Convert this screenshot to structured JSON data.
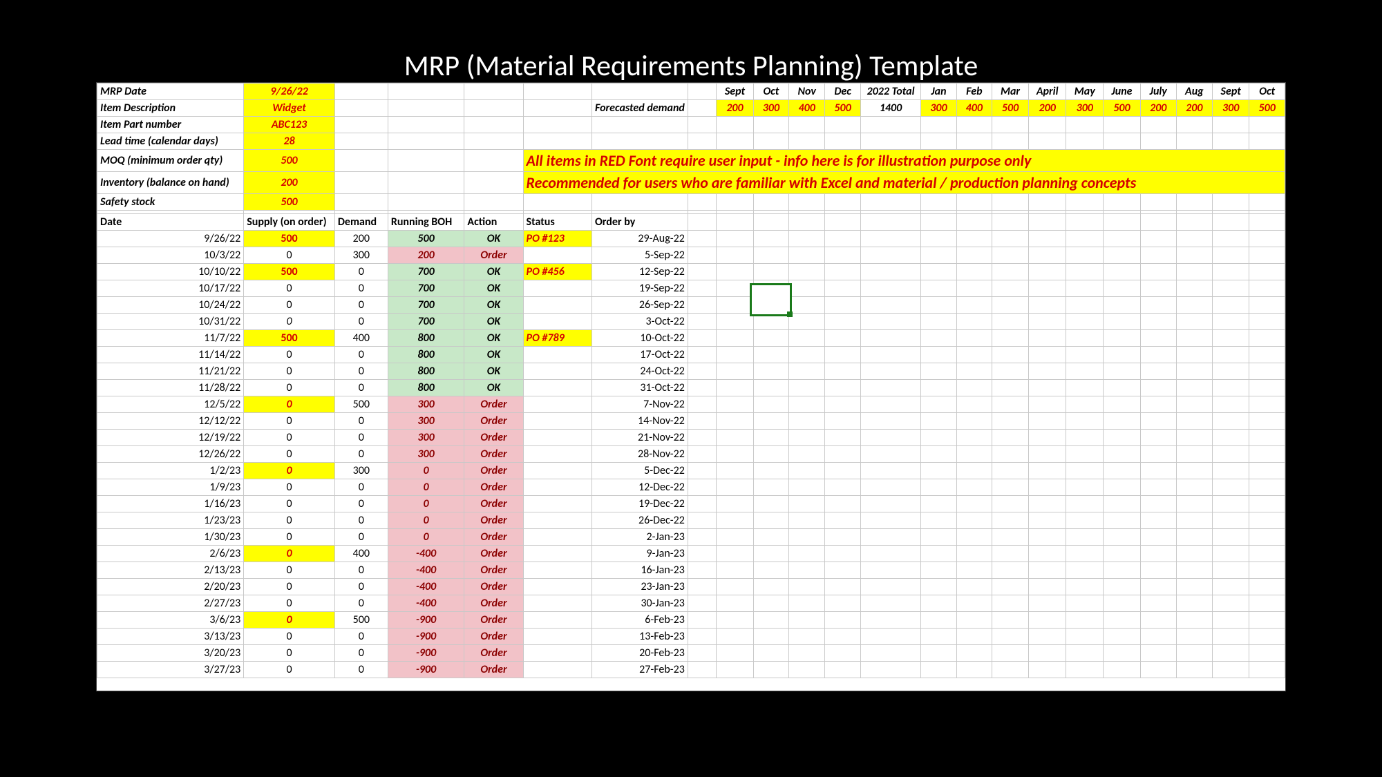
{
  "title": "MRP (Material Requirements Planning) Template",
  "params": {
    "mrp_date_label": "MRP Date",
    "mrp_date": "9/26/22",
    "desc_label": "Item Description",
    "desc": "Widget",
    "part_label": "Item Part number",
    "part": "ABC123",
    "lead_label": "Lead time (calendar days)",
    "lead": "28",
    "moq_label": "MOQ (minimum order qty)",
    "moq": "500",
    "inv_label": "Inventory (balance on hand)",
    "inv": "200",
    "ss_label": "Safety stock",
    "ss": "500"
  },
  "forecast_label": "Forecasted demand",
  "months": [
    "Sept",
    "Oct",
    "Nov",
    "Dec",
    "2022 Total",
    "Jan",
    "Feb",
    "Mar",
    "April",
    "May",
    "June",
    "July",
    "Aug",
    "Sept",
    "Oct"
  ],
  "forecast": [
    "200",
    "300",
    "400",
    "500",
    "1400",
    "300",
    "400",
    "500",
    "200",
    "300",
    "500",
    "200",
    "200",
    "300",
    "500"
  ],
  "banner_line1": "All items in RED Font require user input - info here is for illustration purpose only",
  "banner_line2": "Recommended for users who are familiar with Excel and material / production planning concepts",
  "headers": [
    "Date",
    "Supply (on order)",
    "Demand",
    "Running BOH",
    "Action",
    "Status",
    "Order by"
  ],
  "rows": [
    {
      "date": "9/26/22",
      "supply": "500",
      "supply_hl": true,
      "demand": "200",
      "boh": "500",
      "action": "OK",
      "status": "PO #123",
      "orderby": "29-Aug-22"
    },
    {
      "date": "10/3/22",
      "supply": "0",
      "demand": "300",
      "boh": "200",
      "action": "Order",
      "status": "",
      "orderby": "5-Sep-22"
    },
    {
      "date": "10/10/22",
      "supply": "500",
      "supply_hl": true,
      "demand": "0",
      "boh": "700",
      "action": "OK",
      "status": "PO #456",
      "orderby": "12-Sep-22"
    },
    {
      "date": "10/17/22",
      "supply": "0",
      "demand": "0",
      "boh": "700",
      "action": "OK",
      "status": "",
      "orderby": "19-Sep-22"
    },
    {
      "date": "10/24/22",
      "supply": "0",
      "demand": "0",
      "boh": "700",
      "action": "OK",
      "status": "",
      "orderby": "26-Sep-22"
    },
    {
      "date": "10/31/22",
      "supply": "0",
      "supply_ital": true,
      "demand": "0",
      "boh": "700",
      "action": "OK",
      "status": "",
      "orderby": "3-Oct-22"
    },
    {
      "date": "11/7/22",
      "supply": "500",
      "supply_hl": true,
      "demand": "400",
      "boh": "800",
      "action": "OK",
      "status": "PO #789",
      "orderby": "10-Oct-22"
    },
    {
      "date": "11/14/22",
      "supply": "0",
      "demand": "0",
      "boh": "800",
      "action": "OK",
      "status": "",
      "orderby": "17-Oct-22"
    },
    {
      "date": "11/21/22",
      "supply": "0",
      "demand": "0",
      "boh": "800",
      "action": "OK",
      "status": "",
      "orderby": "24-Oct-22"
    },
    {
      "date": "11/28/22",
      "supply": "0",
      "demand": "0",
      "boh": "800",
      "action": "OK",
      "status": "",
      "orderby": "31-Oct-22"
    },
    {
      "date": "12/5/22",
      "supply": "0",
      "supply_hl": true,
      "supply_ital": true,
      "demand": "500",
      "boh": "300",
      "action": "Order",
      "status": "",
      "orderby": "7-Nov-22"
    },
    {
      "date": "12/12/22",
      "supply": "0",
      "demand": "0",
      "boh": "300",
      "action": "Order",
      "status": "",
      "orderby": "14-Nov-22"
    },
    {
      "date": "12/19/22",
      "supply": "0",
      "demand": "0",
      "boh": "300",
      "action": "Order",
      "status": "",
      "orderby": "21-Nov-22"
    },
    {
      "date": "12/26/22",
      "supply": "0",
      "demand": "0",
      "boh": "300",
      "action": "Order",
      "status": "",
      "orderby": "28-Nov-22"
    },
    {
      "date": "1/2/23",
      "supply": "0",
      "supply_hl": true,
      "supply_ital": true,
      "demand": "300",
      "boh": "0",
      "action": "Order",
      "status": "",
      "orderby": "5-Dec-22"
    },
    {
      "date": "1/9/23",
      "supply": "0",
      "demand": "0",
      "boh": "0",
      "action": "Order",
      "status": "",
      "orderby": "12-Dec-22"
    },
    {
      "date": "1/16/23",
      "supply": "0",
      "demand": "0",
      "boh": "0",
      "action": "Order",
      "status": "",
      "orderby": "19-Dec-22"
    },
    {
      "date": "1/23/23",
      "supply": "0",
      "demand": "0",
      "boh": "0",
      "action": "Order",
      "status": "",
      "orderby": "26-Dec-22"
    },
    {
      "date": "1/30/23",
      "supply": "0",
      "demand": "0",
      "boh": "0",
      "action": "Order",
      "status": "",
      "orderby": "2-Jan-23"
    },
    {
      "date": "2/6/23",
      "supply": "0",
      "supply_hl": true,
      "supply_ital": true,
      "demand": "400",
      "boh": "-400",
      "action": "Order",
      "status": "",
      "orderby": "9-Jan-23"
    },
    {
      "date": "2/13/23",
      "supply": "0",
      "demand": "0",
      "boh": "-400",
      "action": "Order",
      "status": "",
      "orderby": "16-Jan-23"
    },
    {
      "date": "2/20/23",
      "supply": "0",
      "demand": "0",
      "boh": "-400",
      "action": "Order",
      "status": "",
      "orderby": "23-Jan-23"
    },
    {
      "date": "2/27/23",
      "supply": "0",
      "demand": "0",
      "boh": "-400",
      "action": "Order",
      "status": "",
      "orderby": "30-Jan-23"
    },
    {
      "date": "3/6/23",
      "supply": "0",
      "supply_hl": true,
      "supply_ital": true,
      "demand": "500",
      "boh": "-900",
      "action": "Order",
      "status": "",
      "orderby": "6-Feb-23"
    },
    {
      "date": "3/13/23",
      "supply": "0",
      "demand": "0",
      "boh": "-900",
      "action": "Order",
      "status": "",
      "orderby": "13-Feb-23"
    },
    {
      "date": "3/20/23",
      "supply": "0",
      "demand": "0",
      "boh": "-900",
      "action": "Order",
      "status": "",
      "orderby": "20-Feb-23"
    },
    {
      "date": "3/27/23",
      "supply": "0",
      "demand": "0",
      "boh": "-900",
      "action": "Order",
      "status": "",
      "orderby": "27-Feb-23"
    }
  ]
}
